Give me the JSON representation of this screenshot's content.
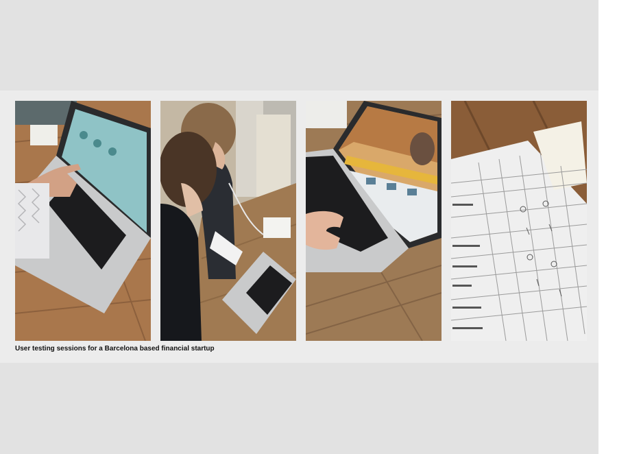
{
  "caption": "User testing sessions for a Barcelona based financial startup",
  "colors": {
    "band_top": "#e2e2e2",
    "band_mid": "#ececec",
    "band_bottom": "#e2e2e2",
    "table_wood": "#a9774c",
    "laptop_silver": "#c9cacb",
    "screen_teal": "#8fc3c6"
  },
  "photos": [
    {
      "label": "photo-pointing-at-laptop"
    },
    {
      "label": "photo-two-testers-at-table"
    },
    {
      "label": "photo-laptop-web-page"
    },
    {
      "label": "photo-test-results-sheet"
    }
  ]
}
